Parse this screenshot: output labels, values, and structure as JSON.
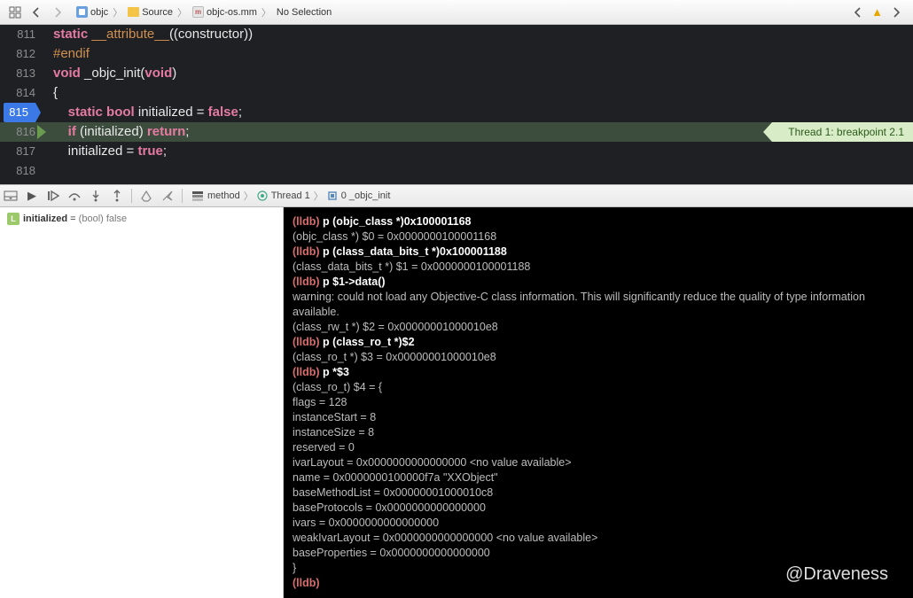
{
  "breadcrumbs": {
    "project": "objc",
    "folder": "Source",
    "file": "objc-os.mm",
    "selection": "No Selection"
  },
  "editor": {
    "lines": [
      {
        "n": "811",
        "tok": [
          [
            "kw",
            "static"
          ],
          [
            "w",
            " "
          ],
          [
            "pp",
            "__attribute__"
          ],
          [
            "p",
            "((constructor))"
          ]
        ]
      },
      {
        "n": "812",
        "tok": [
          [
            "pp",
            "#endif"
          ]
        ]
      },
      {
        "n": "813",
        "tok": [
          [
            "kw",
            "void"
          ],
          [
            "w",
            " "
          ],
          [
            "fn",
            "_objc_init"
          ],
          [
            "p",
            "("
          ],
          [
            "kw",
            "void"
          ],
          [
            "p",
            ")"
          ]
        ]
      },
      {
        "n": "814",
        "tok": [
          [
            "p",
            "{"
          ]
        ]
      },
      {
        "n": "815",
        "bp": true,
        "tok": [
          [
            "w",
            "    "
          ],
          [
            "kw",
            "static"
          ],
          [
            "w",
            " "
          ],
          [
            "kw",
            "bool"
          ],
          [
            "w",
            " "
          ],
          [
            "fn",
            "initialized"
          ],
          [
            "w",
            " = "
          ],
          [
            "kw",
            "false"
          ],
          [
            "p",
            ";"
          ]
        ]
      },
      {
        "n": "816",
        "pc": true,
        "exec": true,
        "tok": [
          [
            "w",
            "    "
          ],
          [
            "kw",
            "if"
          ],
          [
            "w",
            " ("
          ],
          [
            "fn",
            "initialized"
          ],
          [
            "p",
            ") "
          ],
          [
            "kw",
            "return"
          ],
          [
            "p",
            ";"
          ]
        ]
      },
      {
        "n": "817",
        "tok": [
          [
            "w",
            "    "
          ],
          [
            "fn",
            "initialized"
          ],
          [
            "w",
            " = "
          ],
          [
            "kw",
            "true"
          ],
          [
            "p",
            ";"
          ]
        ]
      },
      {
        "n": "818",
        "tok": []
      }
    ],
    "bp_tag": "Thread 1: breakpoint 2.1"
  },
  "debugbar": {
    "crumbs": [
      "method",
      "Thread 1",
      "0 _objc_init"
    ]
  },
  "variables": [
    {
      "name": "initialized",
      "type": "(bool)",
      "value": "false"
    }
  ],
  "console": [
    {
      "p": true,
      "c": "p (objc_class *)0x100001168"
    },
    {
      "o": "(objc_class *) $0 = 0x0000000100001168"
    },
    {
      "p": true,
      "c": "p (class_data_bits_t *)0x100001188"
    },
    {
      "o": "(class_data_bits_t *) $1 = 0x0000000100001188"
    },
    {
      "p": true,
      "c": "p $1->data()"
    },
    {
      "o": "warning: could not load any Objective-C class information. This will significantly reduce the quality of type information available."
    },
    {
      "o": "(class_rw_t *) $2 = 0x00000001000010e8"
    },
    {
      "p": true,
      "c": "p (class_ro_t *)$2"
    },
    {
      "o": "(class_ro_t *) $3 = 0x00000001000010e8"
    },
    {
      "p": true,
      "c": "p *$3"
    },
    {
      "o": "(class_ro_t) $4 = {"
    },
    {
      "o": "  flags = 128"
    },
    {
      "o": "  instanceStart = 8"
    },
    {
      "o": "  instanceSize = 8"
    },
    {
      "o": "  reserved = 0"
    },
    {
      "o": "  ivarLayout = 0x0000000000000000 <no value available>"
    },
    {
      "o": "  name = 0x0000000100000f7a \"XXObject\""
    },
    {
      "o": "  baseMethodList = 0x00000001000010c8"
    },
    {
      "o": "  baseProtocols = 0x0000000000000000"
    },
    {
      "o": "  ivars = 0x0000000000000000"
    },
    {
      "o": "  weakIvarLayout = 0x0000000000000000 <no value available>"
    },
    {
      "o": "  baseProperties = 0x0000000000000000"
    },
    {
      "o": "}"
    },
    {
      "p": true,
      "c": ""
    }
  ],
  "watermark": "@Draveness",
  "lldb_prompt": "(lldb)"
}
